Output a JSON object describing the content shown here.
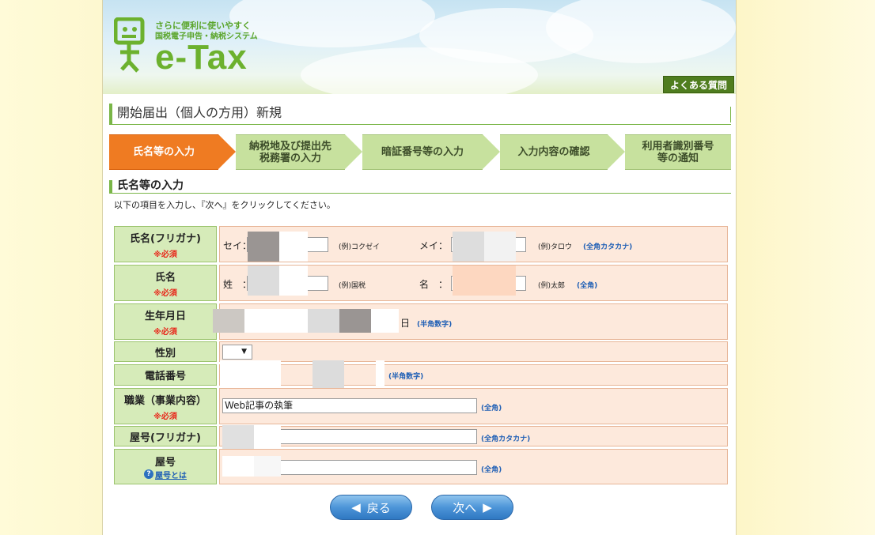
{
  "header": {
    "tagline1": "さらに便利に使いやすく",
    "tagline2": "国税電子申告・納税システム",
    "logo": "e-Tax",
    "faq_label": "よくある質問"
  },
  "page_title": "開始届出（個人の方用）新規",
  "steps": [
    {
      "label": "氏名等の入力",
      "active": true
    },
    {
      "label": "納税地及び提出先\n税務署の入力",
      "active": false
    },
    {
      "label": "暗証番号等の入力",
      "active": false
    },
    {
      "label": "入力内容の確認",
      "active": false
    },
    {
      "label": "利用者識別番号\n等の通知",
      "active": false
    }
  ],
  "section_title": "氏名等の入力",
  "instruction": "以下の項目を入力し、『次へ』をクリックしてください。",
  "required_mark": "※必須",
  "form": {
    "furigana": {
      "label": "氏名(フリガナ)",
      "sei_label": "セイ：",
      "sei_hint": "(例)コクゼイ",
      "mei_label": "メイ：",
      "mei_hint": "(例)タロウ",
      "note": "(全角カタカナ)"
    },
    "name": {
      "label": "氏名",
      "sei_label": "姓　：",
      "sei_hint": "(例)国税",
      "mei_label": "名　：",
      "mei_hint": "(例)太郎",
      "note": "(全角)"
    },
    "birth": {
      "label": "生年月日",
      "day_label": "日",
      "note": "(半角数字)"
    },
    "gender": {
      "label": "性別"
    },
    "phone": {
      "label": "電話番号",
      "note": "(半角数字)"
    },
    "occupation": {
      "label": "職業（事業内容）",
      "value": "Web記事の執筆",
      "note": "(全角)"
    },
    "shop_kana": {
      "label": "屋号(フリガナ)",
      "note": "(全角カタカナ)"
    },
    "shop": {
      "label": "屋号",
      "help_label": "屋号とは",
      "note": "(全角)"
    }
  },
  "buttons": {
    "back": "戻る",
    "next": "次へ"
  },
  "colors": {
    "accent_green": "#7ab648",
    "active_step": "#ef7b22",
    "label_bg": "#d6ebb9",
    "value_bg": "#fde9dc",
    "button_blue": "#4d95d8"
  }
}
